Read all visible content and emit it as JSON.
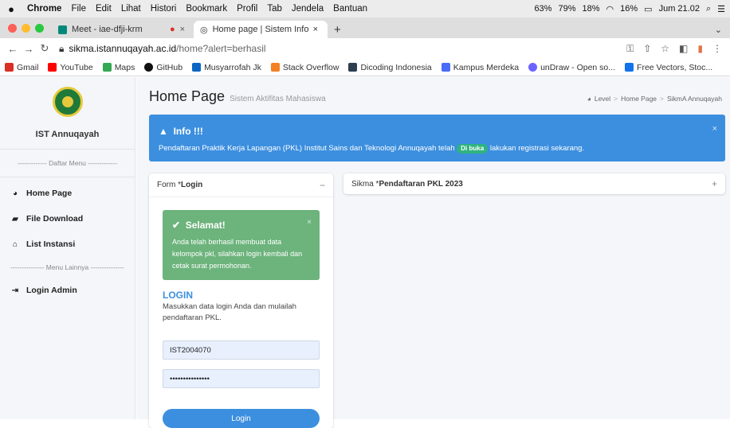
{
  "menubar": {
    "app": "Chrome",
    "items": [
      "File",
      "Edit",
      "Lihat",
      "Histori",
      "Bookmark",
      "Profil",
      "Tab",
      "Jendela",
      "Bantuan"
    ],
    "ssd": "63%",
    "net": "79%",
    "cpu": "18%",
    "battery": "16%",
    "clock": "Jum 21.02"
  },
  "tabs": [
    {
      "title": "Meet - iae-dfji-krm"
    },
    {
      "title": "Home page | Sistem Informasi",
      "active": true
    }
  ],
  "address": {
    "host": "sikma.istannuqayah.ac.id",
    "path": "/home?alert=berhasil"
  },
  "bookmarks": [
    {
      "label": "Gmail",
      "color": "#d93025"
    },
    {
      "label": "YouTube",
      "color": "#ff0000"
    },
    {
      "label": "Maps",
      "color": "#34a853"
    },
    {
      "label": "GitHub",
      "color": "#111111"
    },
    {
      "label": "Musyarrofah Jk",
      "color": "#0a66c2"
    },
    {
      "label": "Stack Overflow",
      "color": "#f48024"
    },
    {
      "label": "Dicoding Indonesia",
      "color": "#2d3e50"
    },
    {
      "label": "Kampus Merdeka",
      "color": "#4a6cf7"
    },
    {
      "label": "unDraw - Open so...",
      "color": "#6c63ff"
    },
    {
      "label": "Free Vectors, Stoc...",
      "color": "#1273eb"
    }
  ],
  "sidebar": {
    "brand": "IST Annuqayah",
    "section1": "------------- Daftar Menu -------------",
    "items": [
      {
        "label": "Home Page",
        "icon": "tachometer-icon"
      },
      {
        "label": "File Download",
        "icon": "book-icon"
      },
      {
        "label": "List Instansi",
        "icon": "home-icon"
      }
    ],
    "section2": "--------------- Menu Lainnya ---------------",
    "admin": {
      "label": "Login Admin",
      "icon": "sign-in-icon"
    }
  },
  "page": {
    "title": "Home Page",
    "subtitle": "Sistem Aktifitas Mahasiswa",
    "breadcrumb": [
      "Level",
      "Home Page",
      "SikmA Annuqayah"
    ]
  },
  "info": {
    "title": "Info !!!",
    "msg_before": "Pendaftaran Praktik Kerja Lapangan (PKL) Institut Sains dan Teknologi Annuqayah telah",
    "badge": "Di buka",
    "msg_after": "lakukan registrasi sekarang."
  },
  "form_card": {
    "title_prefix": "Form *",
    "title_bold": "Login",
    "success_title": "Selamat!",
    "success_msg": "Anda telah berhasil membuat data kelompok pkl, silahkan login kembali dan cetak surat permohonan.",
    "login_title": "LOGIN",
    "login_desc": "Masukkan data login Anda dan mulailah pendaftaran PKL.",
    "username": "IST2004070",
    "password": "•••••••••••••••",
    "button": "Login"
  },
  "sikma_card": {
    "title_prefix": "Sikma *",
    "title_bold": "Pendaftaran PKL 2023"
  },
  "colors": {
    "primary": "#3c8fdf",
    "success": "#6cb37c",
    "badge": "#2fb380"
  }
}
